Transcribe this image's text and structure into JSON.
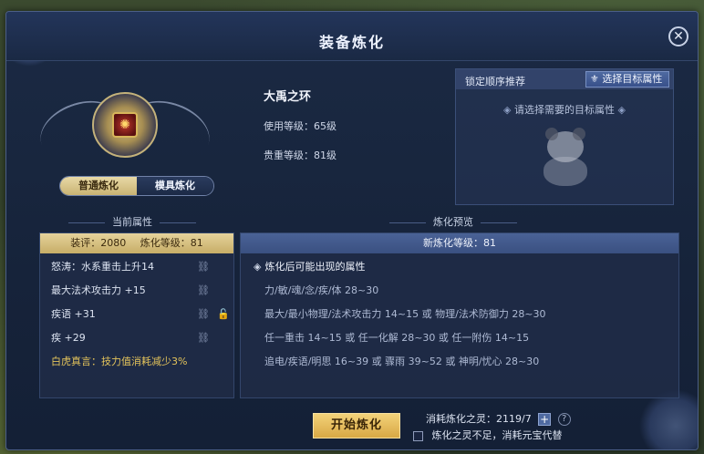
{
  "window": {
    "title": "装备炼化"
  },
  "tabs": [
    {
      "label": "普通炼化",
      "active": false
    },
    {
      "label": "模具炼化",
      "active": true
    }
  ],
  "item": {
    "name": "大禹之环",
    "use_level": "使用等级：65级",
    "rarity_level": "贵重等级：81级"
  },
  "recommend": {
    "label": "锁定顺序推荐",
    "select_button": "选择目标属性",
    "hint": "请选择需要的目标属性"
  },
  "current": {
    "title": "当前属性",
    "score": "装评：2080",
    "refine_level": "炼化等级：81",
    "attributes": [
      {
        "text": "怒涛：水系重击上升14"
      },
      {
        "text": "最大法术攻击力 +15"
      },
      {
        "text": "疾语 +31"
      },
      {
        "text": "疾 +29"
      },
      {
        "text": "白虎真言：技力值消耗减少3%"
      }
    ]
  },
  "preview": {
    "title": "炼化预览",
    "new_level": "新炼化等级：81",
    "possible_header": "炼化后可能出现的属性",
    "rows": [
      "力/敏/魂/念/疾/体 28~30",
      "最大/最小物理/法术攻击力 14~15 或 物理/法术防御力 28~30",
      "任一重击 14~15 或 任一化解 28~30 或 任一附伤 14~15",
      "追电/疾语/明思 16~39 或 骤雨 39~52 或 神明/忧心 28~30"
    ]
  },
  "footer": {
    "start_button": "开始炼化",
    "cost_label": "消耗炼化之灵：2119/7",
    "substitute_label": "炼化之灵不足，消耗元宝代替"
  },
  "colors": {
    "gold_header": "#c7ad67",
    "preview_header": "#3a5081",
    "special_attr": "#e3c35b"
  }
}
